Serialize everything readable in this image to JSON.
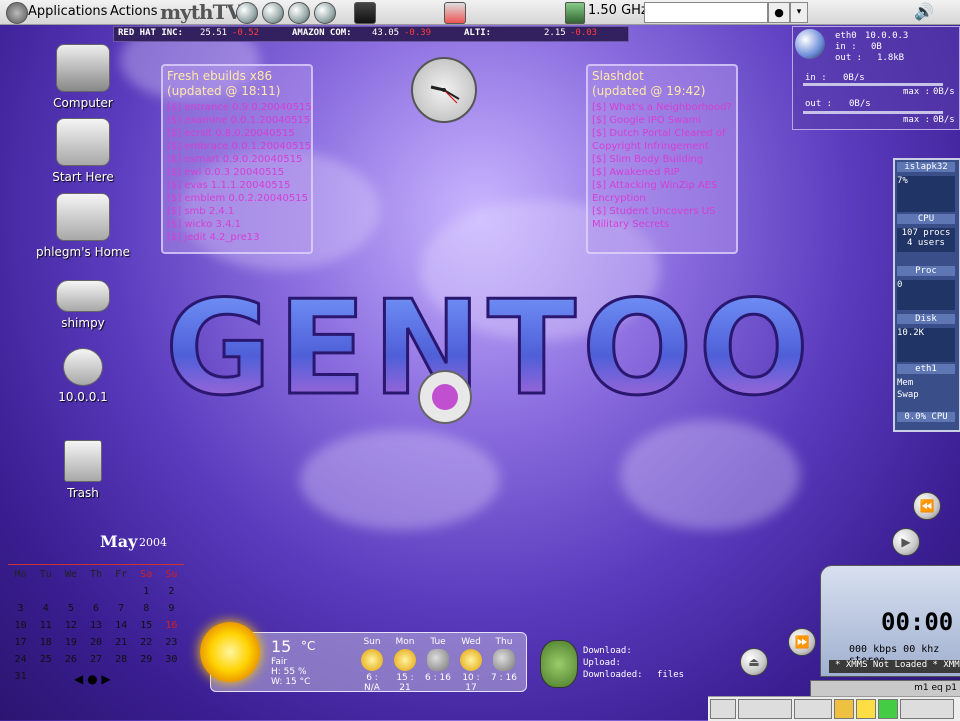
{
  "top_panel": {
    "applications": "Applications",
    "actions": "Actions",
    "mythtv": "mythTV",
    "cpu_freq": "1.50 GHz",
    "entry_value": "",
    "btn1": "●",
    "btn2": "▾"
  },
  "ticker": [
    {
      "name": "RED HAT INC:",
      "price": "25.51",
      "change": "-0.52"
    },
    {
      "name": "AMAZON COM:",
      "price": "43.05",
      "change": "-0.39"
    },
    {
      "name": "ALTI:",
      "price": "2.15",
      "change": "-0.03"
    }
  ],
  "desktop_icons": [
    {
      "label": "Computer",
      "icon": "computer-icon"
    },
    {
      "label": "Start Here",
      "icon": "start-here-icon"
    },
    {
      "label": "phlegm's Home",
      "icon": "home-folder-icon"
    },
    {
      "label": "shimpy",
      "icon": "drive-icon"
    },
    {
      "label": "10.0.0.1",
      "icon": "network-icon"
    },
    {
      "label": "Trash",
      "icon": "trash-icon"
    }
  ],
  "ebuilds": {
    "title": "Fresh ebuilds  x86",
    "updated": "(updated @ 18:11)",
    "items": [
      "[$] entrance 0.9.0.20040515",
      "[$] examine 0.0.1.20040515",
      "[$] ecrsit 0.8.0.20040515",
      "[$] embrace 0.0.1.20040515",
      "[$] esmart 0.9.0.20040515",
      "[$] ewl 0.0.3 20040515",
      "[$] evas 1.1.1.20040515",
      "[$] emblem 0.0.2.20040515",
      "[$] smb 2.4.1",
      "[$] wicko 3.4.1",
      "[$] jedit 4.2_pre13"
    ]
  },
  "slashdot": {
    "title": "Slashdot",
    "updated": "(updated @ 19:42)",
    "items": [
      "[$] What's a Neighborhood?",
      "[$] Google IPO Swami",
      "[$] Dutch Portal Cleared of",
      "Copyright Infringement",
      "[$] Slim Body Building",
      "[$] Awakened RIP",
      "[$] Attacking WinZip AES",
      "Encryption",
      "[$] Student Uncovers US",
      "Military Secrets"
    ]
  },
  "logo_text": "GENTOO",
  "netmon": {
    "iface": "eth0",
    "ip": "10.0.0.3",
    "in_label": "in :",
    "in_total": "0B",
    "out_label": "out :",
    "out_total": "1.8kB",
    "in_rate_label": "in :",
    "in_rate": "0B/s",
    "max_label": "max :",
    "in_max": "0B/s",
    "out_rate_label": "out :",
    "out_rate": "0B/s",
    "out_max": "0B/s"
  },
  "gkrellm": {
    "host": "islapk32",
    "cpu_pct": "7%",
    "cpu_label": "CPU",
    "procs": "107 procs",
    "users": "4 users",
    "proc_label": "Proc",
    "proc_val": "0",
    "disk_label": "Disk",
    "disk_val": "10.2K",
    "net_label": "eth1",
    "mem_label": "Mem",
    "swap_label": "Swap",
    "cpu_foot": "0.0% CPU"
  },
  "calendar": {
    "month": "May",
    "year": "2004",
    "headers": [
      "Mo",
      "Tu",
      "We",
      "Th",
      "Fr",
      "Sa",
      "Su"
    ],
    "weeks": [
      [
        "",
        "",
        "",
        "",
        "",
        "1",
        "2"
      ],
      [
        "3",
        "4",
        "5",
        "6",
        "7",
        "8",
        "9"
      ],
      [
        "10",
        "11",
        "12",
        "13",
        "14",
        "15",
        "16"
      ],
      [
        "17",
        "18",
        "19",
        "20",
        "21",
        "22",
        "23"
      ],
      [
        "24",
        "25",
        "26",
        "27",
        "28",
        "29",
        "30"
      ],
      [
        "31",
        "",
        "",
        "",
        "",
        "",
        ""
      ]
    ],
    "today": "16"
  },
  "weather": {
    "temp": "15",
    "unit": "°C",
    "cond": "Fair",
    "humidity": "H: 55 %",
    "wind": "W: 15 °C",
    "days": [
      {
        "name": "Sun",
        "range": "6 : N/A",
        "icon": "sun"
      },
      {
        "name": "Mon",
        "range": "15 : 21",
        "icon": "partly-sunny"
      },
      {
        "name": "Tue",
        "range": "6 : 16",
        "icon": "rain"
      },
      {
        "name": "Wed",
        "range": "10 : 17",
        "icon": "partly-sunny"
      },
      {
        "name": "Thu",
        "range": "7 : 16",
        "icon": "rain"
      }
    ]
  },
  "downloads": {
    "download": "Download:",
    "upload": "Upload:",
    "downloaded": "Downloaded:",
    "files": "files"
  },
  "xmms": {
    "time": "00:00",
    "rate": "000 kbps 00 khz stereo",
    "title": "* XMMS Not Loaded * XMM",
    "ctl": "m1  eq  p1"
  }
}
